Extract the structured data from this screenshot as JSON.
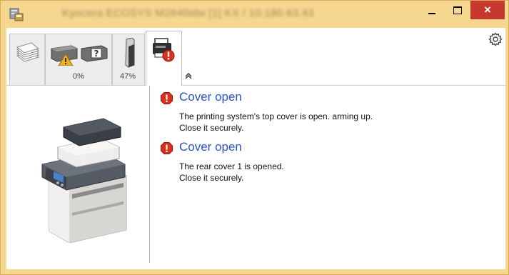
{
  "window": {
    "title": "Kyocera ECOSYS M2640idw [1] KX / 10.180.63.43",
    "controls": {
      "minimize": "minimize",
      "maximize": "maximize",
      "close": "×"
    }
  },
  "toolbar": {
    "tabs": [
      {
        "name": "paper",
        "icon": "paper-stack-icon",
        "label": ""
      },
      {
        "name": "toner",
        "icon": "toner-warning-icon",
        "label": "0%",
        "warning": true
      },
      {
        "name": "memory",
        "icon": "memory-icon",
        "label": "47%"
      },
      {
        "name": "status",
        "icon": "printer-error-icon",
        "label": "",
        "active": true
      }
    ],
    "collapse_icon": "chevron-up-icon",
    "settings_icon": "gear-icon"
  },
  "device": {
    "icon": "multifunction-printer-icon"
  },
  "messages": [
    {
      "title": "Cover open",
      "lines": [
        "The printing system's top cover is open.   arming up.",
        "Close it securely."
      ],
      "icon": "error-icon"
    },
    {
      "title": "Cover open",
      "lines": [
        "The rear cover 1 is opened.",
        "Close it securely."
      ],
      "icon": "error-icon"
    }
  ],
  "colors": {
    "frame": "#f6d78f",
    "close_button": "#c7382e",
    "message_title": "#2a55c0",
    "error": "#d92f1e"
  }
}
